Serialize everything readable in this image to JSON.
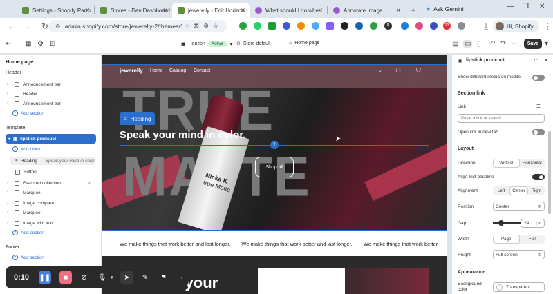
{
  "browser": {
    "tabs": [
      {
        "title": "Settings - Shopify Partn",
        "color": "#5e8e3e"
      },
      {
        "title": "Stores - Dev Dashboard",
        "color": "#5e8e3e"
      },
      {
        "title": "jewerelly - Edit Horizon",
        "color": "#5e8e3e"
      },
      {
        "title": "What should I do whe",
        "color": "#9b59d0"
      },
      {
        "title": "Annotate Image",
        "color": "#9b59d0"
      }
    ],
    "new_tab": "+",
    "ask_gemini": "Ask Gemini",
    "url": "admin.shopify.com/store/jewerelly-2/themes/1...",
    "user_label": "Hi, Shopify",
    "ext_badge": "8",
    "ext_badge2": "23"
  },
  "editor_bar": {
    "theme_name": "Horizon",
    "theme_status": "Active",
    "store_default": "Store default",
    "page": "Home page",
    "save_label": "Save"
  },
  "left_panel": {
    "title": "Home page",
    "header_section": "Header",
    "header_items": [
      "Announcement bar",
      "Header",
      "Announcement bar"
    ],
    "add_section": "Add section",
    "template_section": "Template",
    "selected": "lipstick prodcuct",
    "add_block": "Add block",
    "heading_item": "Heading",
    "heading_preview": "Speak your mind in color",
    "button_item": "Button",
    "template_items": [
      "Featured collection",
      "Marquee",
      "Image compare",
      "Marquee",
      "Image with text"
    ],
    "footer_section": "Footer"
  },
  "preview": {
    "store_logo": "jewerelly",
    "menu": [
      "Home",
      "Catalog",
      "Contact"
    ],
    "bg_text": "TRUE MATTE",
    "tube_brand": "Nicka K",
    "tube_sub": "true Matte",
    "heading_badge": "Heading",
    "headline": "Speak your mind in color.",
    "cta": "Shop all",
    "marquee": [
      "We make things that work better and last longer.",
      "We make things that work better and last longer.",
      "We make things that work better"
    ],
    "lower_heading": "Find your"
  },
  "right_panel": {
    "title": "lipstick prodcuct",
    "show_diff_media": "Show different media on mobile",
    "section_link": "Section link",
    "link_label": "Link",
    "link_placeholder": "Paste a link or search",
    "open_new_tab": "Open link in new tab",
    "layout": "Layout",
    "direction_label": "Direction",
    "direction_options": [
      "Vertical",
      "Horizontal"
    ],
    "align_baseline": "Align text baseline",
    "alignment_label": "Alignment",
    "alignment_options": [
      "Left",
      "Center",
      "Right"
    ],
    "position_label": "Position",
    "position_value": "Center",
    "gap_label": "Gap",
    "gap_value": "24",
    "gap_unit": "px",
    "width_label": "Width",
    "width_options": [
      "Page",
      "Full"
    ],
    "height_label": "Height",
    "height_value": "Full screen",
    "appearance": "Appearance",
    "bg_color_label": "Background color",
    "bg_color_value": "Transparent"
  },
  "recorder": {
    "time": "0:10"
  },
  "colors": {
    "accent": "#2c6ecb",
    "active_badge": "#c8f0d2"
  }
}
